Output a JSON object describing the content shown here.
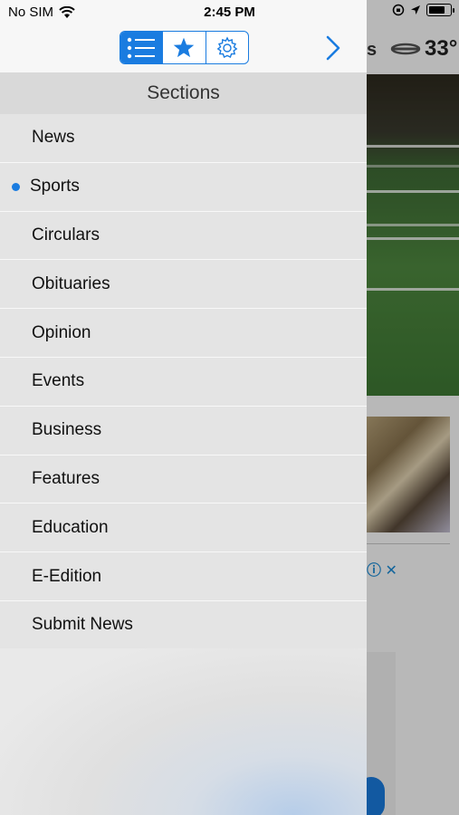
{
  "status_bar": {
    "carrier": "No SIM",
    "time": "2:45 PM"
  },
  "background": {
    "partial_text": "s",
    "temperature": "33°"
  },
  "drawer": {
    "tabs": [
      {
        "icon": "list-icon",
        "active": true
      },
      {
        "icon": "star-icon",
        "active": false
      },
      {
        "icon": "gear-icon",
        "active": false
      }
    ],
    "header": "Sections",
    "items": [
      {
        "label": "News",
        "selected": false
      },
      {
        "label": "Sports",
        "selected": true
      },
      {
        "label": "Circulars",
        "selected": false
      },
      {
        "label": "Obituaries",
        "selected": false
      },
      {
        "label": "Opinion",
        "selected": false
      },
      {
        "label": "Events",
        "selected": false
      },
      {
        "label": "Business",
        "selected": false
      },
      {
        "label": "Features",
        "selected": false
      },
      {
        "label": "Education",
        "selected": false
      },
      {
        "label": "E-Edition",
        "selected": false
      },
      {
        "label": "Submit News",
        "selected": false
      }
    ]
  },
  "colors": {
    "accent": "#1a7ce0",
    "drawer_bg": "#e4e4e4",
    "header_bg": "#d9d9d9"
  }
}
